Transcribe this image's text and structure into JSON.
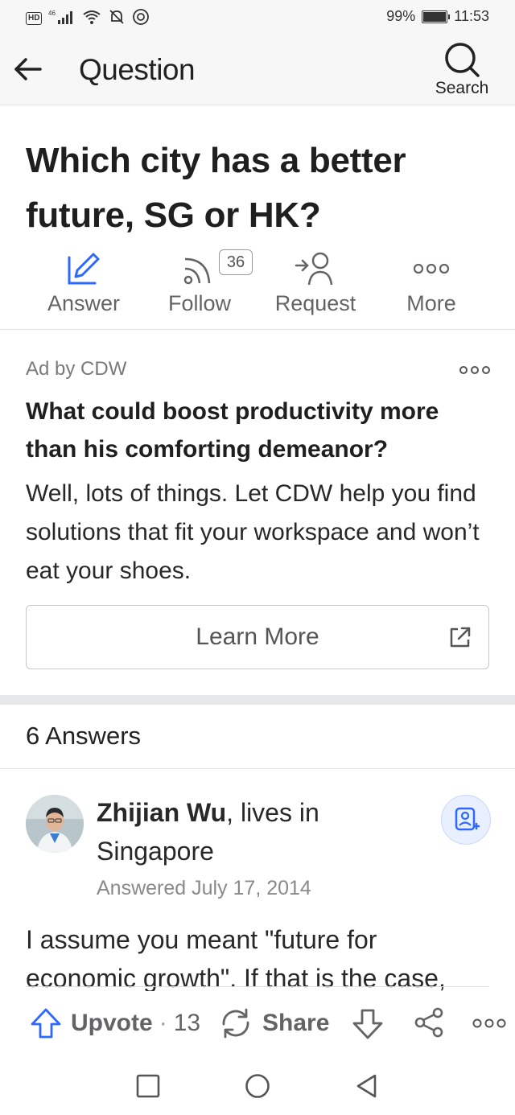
{
  "status_bar": {
    "network": "46",
    "hd": "HD",
    "battery": "99%",
    "time": "11:53"
  },
  "header": {
    "title": "Question",
    "search_label": "Search"
  },
  "question": {
    "title": "Which city has a better future, SG or HK?",
    "actions": {
      "answer": "Answer",
      "follow": "Follow",
      "follow_count": "36",
      "request": "Request",
      "more": "More"
    }
  },
  "ad": {
    "by": "Ad by CDW",
    "headline": "What could boost productivity more than his comforting demeanor?",
    "body": "Well, lots of things. Let CDW help you find solutions that fit your workspace and won’t eat your shoes.",
    "cta": "Learn More"
  },
  "answers": {
    "count_label": "6 Answers",
    "first": {
      "author_name": "Zhijian Wu",
      "author_detail": ", lives in Singapore",
      "answered": "Answered July 17, 2014",
      "text": "I assume you meant \"future for economic growth\". If that is the case,",
      "upvote_label": "Upvote",
      "upvote_count": "13",
      "share_label": "Share"
    }
  },
  "colors": {
    "accent_blue": "#2e69ff",
    "text": "#282829",
    "secondary": "#636466"
  }
}
